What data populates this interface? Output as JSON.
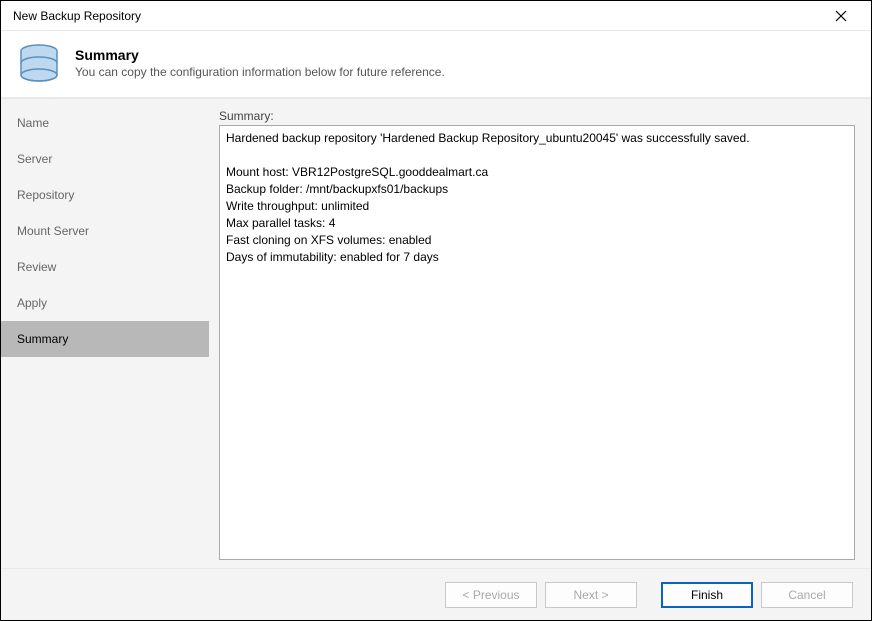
{
  "window": {
    "title": "New Backup Repository"
  },
  "header": {
    "heading": "Summary",
    "subheading": "You can copy the configuration information below for future reference."
  },
  "sidebar": {
    "steps": [
      {
        "label": "Name"
      },
      {
        "label": "Server"
      },
      {
        "label": "Repository"
      },
      {
        "label": "Mount Server"
      },
      {
        "label": "Review"
      },
      {
        "label": "Apply"
      },
      {
        "label": "Summary",
        "active": true
      }
    ]
  },
  "main": {
    "label": "Summary:",
    "content": "Hardened backup repository 'Hardened Backup Repository_ubuntu20045' was successfully saved.\n\nMount host: VBR12PostgreSQL.gooddealmart.ca\nBackup folder: /mnt/backupxfs01/backups\nWrite throughput: unlimited\nMax parallel tasks: 4\nFast cloning on XFS volumes: enabled\nDays of immutability: enabled for 7 days"
  },
  "footer": {
    "previous": "< Previous",
    "next": "Next >",
    "finish": "Finish",
    "cancel": "Cancel"
  }
}
